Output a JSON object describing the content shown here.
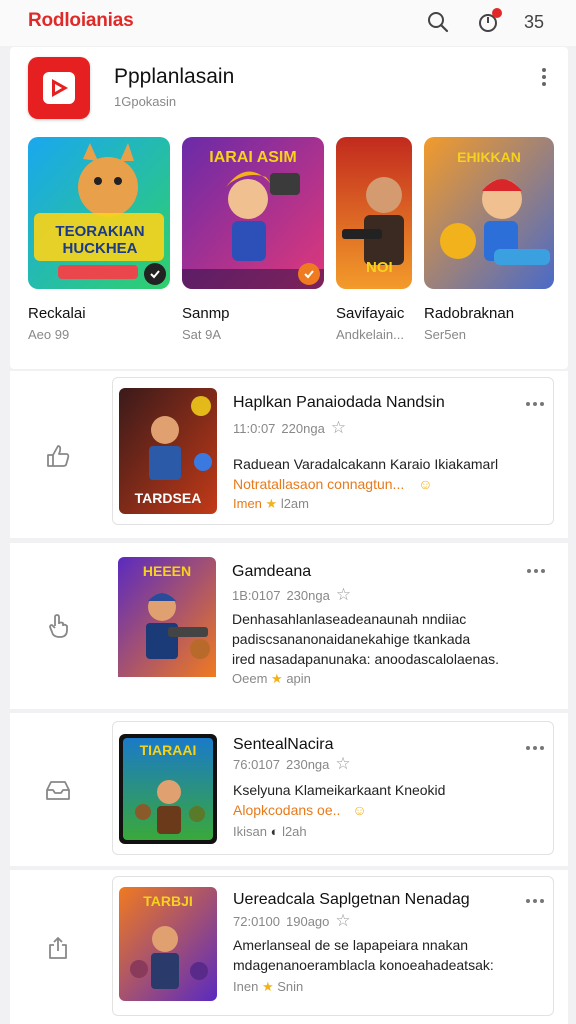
{
  "header": {
    "brand": "Rodloianias",
    "count": "35"
  },
  "app": {
    "title": "Ppplanlasain",
    "subtitle": "1Gpokasin"
  },
  "featured": [
    {
      "art_text": "TEORAKIAN HUCKHEA",
      "name": "Reckalai",
      "meta": "Aeo 99"
    },
    {
      "art_text": "IARAI ASIM",
      "name": "Sanmp",
      "meta": "Sat 9A"
    },
    {
      "art_text": "NOI",
      "name": "Savifayaic",
      "meta": "Andkelain..."
    },
    {
      "art_text": "EHIKKAN",
      "name": "Radobraknan",
      "meta": "Ser5en"
    }
  ],
  "rows": [
    {
      "title": "Haplkan Panaiodada Nandsin",
      "date": "11:0:07",
      "stat": "220nga",
      "desc1": "Raduean Varadalcakann Karaio Ikiakamarl",
      "desc2": "Notratallasaon connagtun...",
      "foot_a": "Imen",
      "foot_b": "l2am",
      "thumb_text": "TARDSEA"
    },
    {
      "title": "Gamdeana",
      "date": "1B:0107",
      "stat": "230nga",
      "desc1": "Denhasahlanlaseadeanaunah nndiiac",
      "desc2": "padiscsananonaidanekahige tkankada",
      "desc3": "ired nasadapanunaka: anoodascalolaenas.",
      "foot_a": "Oeem",
      "foot_b": "apin",
      "thumb_text": "HEEEN"
    },
    {
      "title": "SentealNacira",
      "date": "76:0107",
      "stat": "230nga",
      "desc1": "Kselyuna Klameikarkaant Kneokid",
      "desc2": "Alopkcodans oe..",
      "foot_a": "Ikisan",
      "foot_b": "l2ah",
      "thumb_text": "TIARAAI"
    },
    {
      "title": "Uereadcala Saplgetnan Nenadag",
      "date": "72:0100",
      "stat": "190ago",
      "desc1": "Amerlanseal de se lapapeiara nnakan",
      "desc2": "mdagenanoeramblacla konoeahadeatsak:",
      "foot_a": "Inen",
      "foot_b": "Snin",
      "thumb_text": "TARBJI"
    }
  ],
  "colors": {
    "brand": "#e02a2a",
    "accent": "#e87a1a",
    "star": "#f2b21b"
  }
}
